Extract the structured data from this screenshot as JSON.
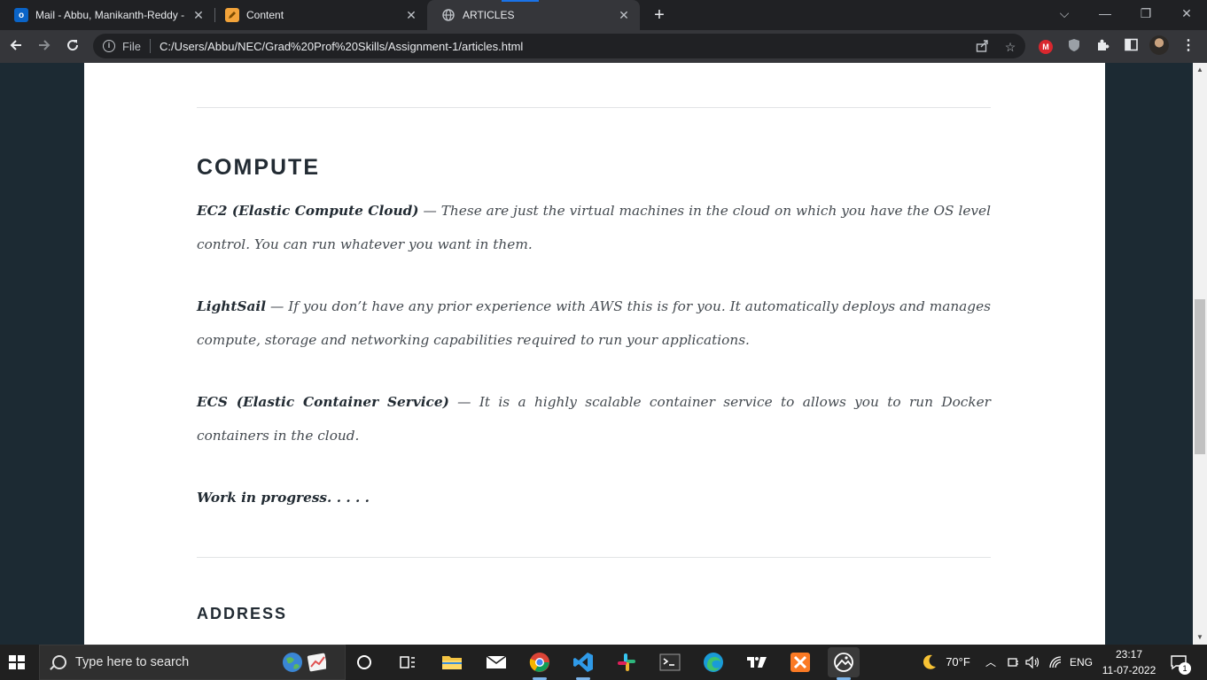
{
  "browser": {
    "tabs": [
      {
        "title": "Mail - Abbu, Manikanth-Reddy -",
        "favicon": "outlook-icon",
        "favicon_text": "o",
        "favicon_color": "#0a64c8",
        "active": false
      },
      {
        "title": "Content",
        "favicon": "pencil-document-icon",
        "favicon_text": "",
        "favicon_color": "#f2a33a",
        "active": false
      },
      {
        "title": "ARTICLES",
        "favicon": "globe-icon",
        "favicon_text": "",
        "favicon_color": "#5f6368",
        "active": true
      }
    ],
    "new_tab_label": "+",
    "address": {
      "scheme_label": "File",
      "url": "C:/Users/Abbu/NEC/Grad%20Prof%20Skills/Assignment-1/articles.html"
    },
    "extensions": [
      {
        "name": "mega-extension-icon",
        "text": "M",
        "color": "#d9272e"
      },
      {
        "name": "shield-extension-icon",
        "text": "",
        "color": "#9aa0a6"
      },
      {
        "name": "puzzle-extensions-icon",
        "text": "",
        "color": "#e8eaed"
      },
      {
        "name": "sidepanel-icon",
        "text": "",
        "color": "#e8eaed"
      }
    ]
  },
  "page": {
    "compute": {
      "heading": "COMPUTE",
      "items": [
        {
          "term": "EC2 (Elastic Compute Cloud)",
          "desc": " — These are just the virtual machines in the cloud on which you have the OS level control. You can run whatever you want in them."
        },
        {
          "term": "LightSail",
          "desc": " — If you don’t have any prior experience with AWS this is for you. It automatically deploys and manages compute, storage and networking capabilities required to run your applications."
        },
        {
          "term": "ECS (Elastic Container Service)",
          "desc": " — It is a highly scalable container service to allows you to run Docker containers in the cloud."
        }
      ],
      "footer_note": "Work in progress. . . . ."
    },
    "address_heading": "ADDRESS",
    "colors": {
      "page_background": "#1c2a33",
      "card_background": "#ffffff",
      "heading_color": "#222b33",
      "body_text_color": "#444a50"
    }
  },
  "taskbar": {
    "search_placeholder": "Type here to search",
    "apps": [
      {
        "name": "widgets-globe-icon",
        "active": false
      },
      {
        "name": "cortana-circle-icon",
        "active": false
      },
      {
        "name": "task-view-icon",
        "active": false
      },
      {
        "name": "file-explorer-icon",
        "active": false
      },
      {
        "name": "mail-icon",
        "active": false
      },
      {
        "name": "chrome-icon",
        "active": true
      },
      {
        "name": "vscode-icon",
        "active": true
      },
      {
        "name": "slack-icon",
        "active": false
      },
      {
        "name": "terminal-icon",
        "active": false
      },
      {
        "name": "edge-icon",
        "active": false
      },
      {
        "name": "tradingview-icon",
        "active": false
      },
      {
        "name": "xampp-icon",
        "active": false
      },
      {
        "name": "photos-icon",
        "active": true
      }
    ],
    "weather": {
      "temp": "70°F",
      "icon": "moon-icon"
    },
    "language": "ENG",
    "time": "23:17",
    "date": "11-07-2022",
    "notification_count": "1"
  }
}
